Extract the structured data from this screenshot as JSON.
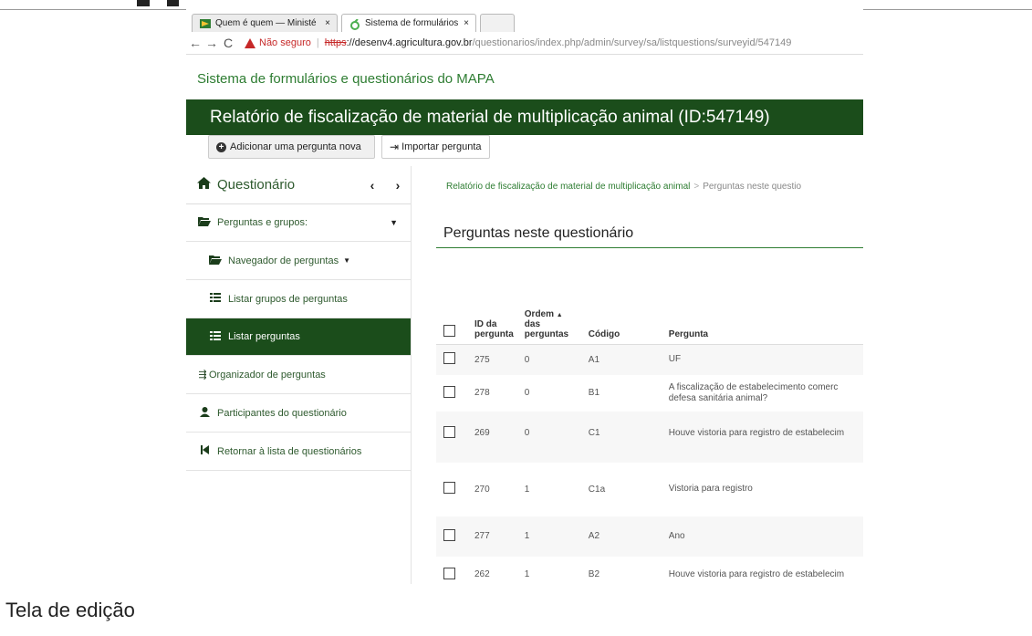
{
  "browser": {
    "tabs": [
      {
        "title": "Quem é quem — Ministé",
        "close": "×",
        "icon": "site-icon"
      },
      {
        "title": "Sistema de formulários e",
        "close": "×",
        "icon": "limesurvey-icon"
      },
      {
        "title": "",
        "close": "",
        "icon": ""
      }
    ],
    "address": {
      "insecure_label": "Não seguro",
      "scheme": "https",
      "host_part": "://desenv4.agricultura.gov.br",
      "path_part": "/questionarios/index.php/admin/survey/sa/listquestions/surveyid/547149"
    }
  },
  "site_title": "Sistema de formulários e questionários do MAPA",
  "banner_title": "Relatório de fiscalização de material de multiplicação animal (ID:547149)",
  "toolbar": {
    "add_question": "Adicionar uma pergunta nova",
    "import_question": "Importar pergunta"
  },
  "sidebar": {
    "header": "Questionário",
    "items": [
      {
        "label": "Perguntas e grupos:",
        "icon": "folder-open-icon"
      },
      {
        "label": "Navegador de perguntas",
        "icon": "folder-open-icon"
      },
      {
        "label": "Listar grupos de perguntas",
        "icon": "list-icon"
      },
      {
        "label": "Listar perguntas",
        "icon": "list-icon"
      },
      {
        "label": "Organizador de perguntas",
        "icon": "organizer-icon"
      },
      {
        "label": "Participantes do questionário",
        "icon": "user-icon"
      },
      {
        "label": "Retornar à lista de questionários",
        "icon": "step-back-icon"
      }
    ]
  },
  "breadcrumb": {
    "link": "Relatório de fiscalização de material de multiplicação animal",
    "separator": ">",
    "current": "Perguntas neste questio"
  },
  "page_heading": "Perguntas neste questionário",
  "table": {
    "headers": {
      "id_line1": "ID da",
      "id_line2": "pergunta",
      "order_line1": "Ordem",
      "order_line2": "das",
      "order_line3": "perguntas",
      "sort_indicator": "▲",
      "code": "Código",
      "question": "Pergunta"
    },
    "rows": [
      {
        "id": "275",
        "order": "0",
        "code": "A1",
        "question_l1": "UF",
        "question_l2": ""
      },
      {
        "id": "278",
        "order": "0",
        "code": "B1",
        "question_l1": "A fiscalização de estabelecimento comerc",
        "question_l2": "defesa sanitária animal?"
      },
      {
        "id": "269",
        "order": "0",
        "code": "C1",
        "question_l1": "Houve vistoria para registro de estabelecim",
        "question_l2": ""
      },
      {
        "id": "270",
        "order": "1",
        "code": "C1a",
        "question_l1": "Vistoria para registro",
        "question_l2": ""
      },
      {
        "id": "277",
        "order": "1",
        "code": "A2",
        "question_l1": "Ano",
        "question_l2": ""
      },
      {
        "id": "262",
        "order": "1",
        "code": "B2",
        "question_l1": "Houve vistoria para registro de estabelecim",
        "question_l2": ""
      }
    ]
  },
  "caption": "Tela de edição",
  "colors": {
    "brand_green": "#1b4d1b",
    "link_green": "#2e7d32",
    "insecure_red": "#c62828"
  }
}
